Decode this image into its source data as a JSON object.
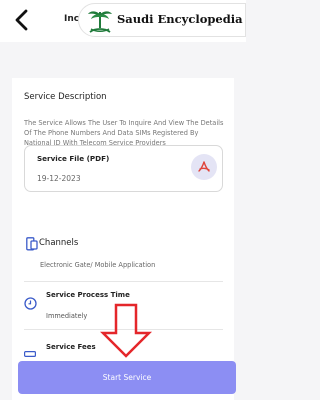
{
  "header": {
    "title_partial": "Inc",
    "watermark_text": "Saudi Encyclopedia"
  },
  "service": {
    "description_title": "Service Description",
    "description_text": "The Service Allows The User To Inquire And View The Details Of The Phone Numbers And Data SIMs Registered By National ID With Telecom Service Providers",
    "file": {
      "label": "Service File (PDF)",
      "date": "19-12-2023"
    },
    "channels": {
      "title": "Channels",
      "value": "Electronic Gate/ Mobile Application"
    },
    "process_time": {
      "title": "Service Process Time",
      "value": "Immediately"
    },
    "fees": {
      "title": "Service Fees"
    }
  },
  "actions": {
    "start_label": "Start Service"
  },
  "colors": {
    "accent": "#8c8ef3",
    "pdf_red": "#e0433a",
    "arrow_red": "#e4262a"
  },
  "icons": [
    "back-arrow-icon",
    "palm-swords-logo-icon",
    "pdf-icon",
    "channels-icon",
    "clock-icon",
    "fees-icon",
    "down-arrow-annotation-icon"
  ]
}
